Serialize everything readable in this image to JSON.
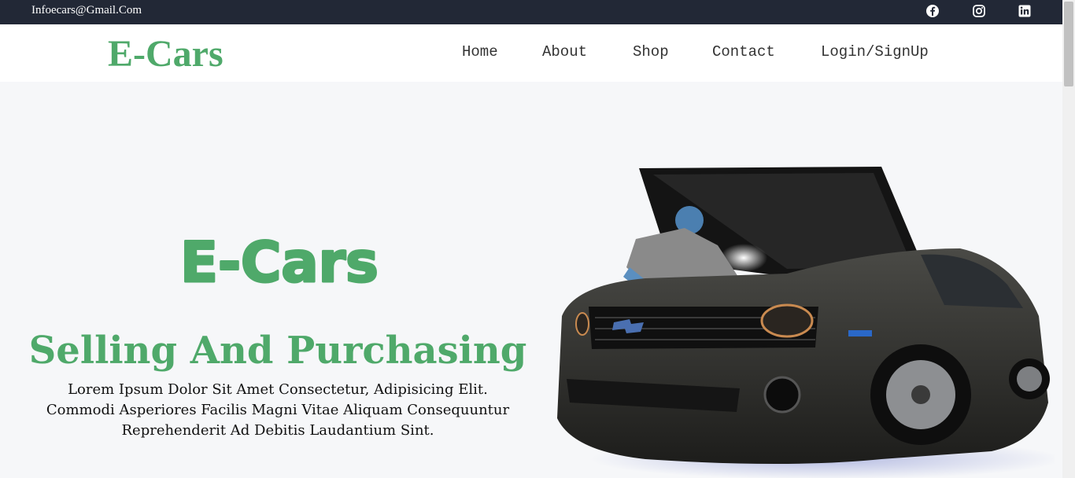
{
  "topbar": {
    "email": "Infoecars@Gmail.Com",
    "social": [
      {
        "icon": "facebook-icon"
      },
      {
        "icon": "instagram-icon"
      },
      {
        "icon": "linkedin-icon"
      }
    ]
  },
  "navbar": {
    "brand": "E-Cars",
    "links": [
      "Home",
      "About",
      "Shop",
      "Contact",
      "Login/SignUp"
    ]
  },
  "hero": {
    "logo_text": "E-Cars",
    "title": "Selling And Purchasing",
    "lines": [
      "Lorem Ipsum Dolor Sit Amet Consectetur, Adipisicing Elit.",
      "Commodi Asperiores Facilis Magni Vitae Aliquam Consequuntur",
      "Reprehenderit Ad Debitis Laudantium Sint."
    ],
    "image": "car-mechanic-illustration"
  },
  "colors": {
    "accent": "#4fa96a",
    "topbar": "#222836",
    "background": "#f6f7f9"
  }
}
